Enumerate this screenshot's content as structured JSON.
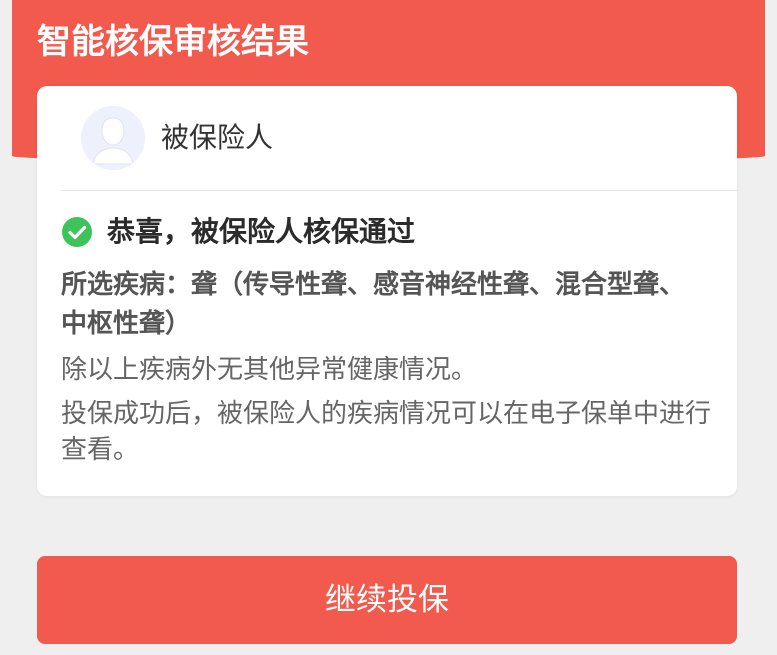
{
  "header": {
    "title": "智能核保审核结果"
  },
  "insured": {
    "avatar_icon": "person-avatar-icon",
    "label": "被保险人"
  },
  "result": {
    "status_icon": "check-circle-icon",
    "status_color": "#3ec35a",
    "message": "恭喜，被保险人核保通过",
    "disease_text": "所选疾病：聋（传导性聋、感音神经性聋、混合型聋、中枢性聋）",
    "note_line_1": "除以上疾病外无其他异常健康情况。",
    "note_line_2": "投保成功后，被保险人的疾病情况可以在电子保单中进行查看。"
  },
  "actions": {
    "continue_label": "继续投保"
  },
  "colors": {
    "brand": "#f15a4d",
    "background": "#efefef",
    "card": "#ffffff"
  }
}
